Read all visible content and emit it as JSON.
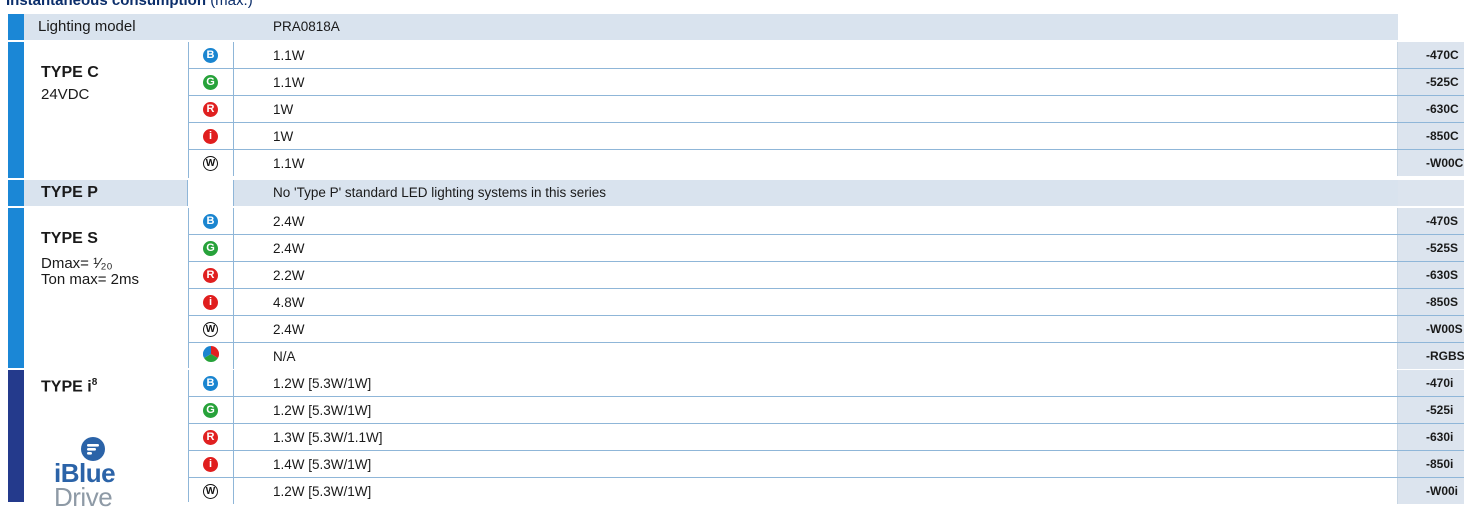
{
  "page": {
    "heading": "Instantaneous consumption",
    "heading_note": "(max.)"
  },
  "header_row": {
    "label": "Lighting model",
    "model": "PRA0818A"
  },
  "colors": {
    "type_c_bar": "#1b87d6",
    "type_s_bar": "#1b87d6",
    "type_i_bar": "#243a8c",
    "blue": "#1a85d0",
    "green": "#27a23a",
    "red": "#e02020",
    "ir": "#e01e1e",
    "header_bg": "#d9e3ee",
    "code_bg": "#dce4ee"
  },
  "groups": [
    {
      "id": "type_c",
      "title": "TYPE C",
      "subtitle": [
        "24VDC"
      ],
      "rows": [
        {
          "icon": "blue-led-icon",
          "badge": "B",
          "value": "1.1W",
          "code": "-470C"
        },
        {
          "icon": "green-led-icon",
          "badge": "G",
          "value": "1.1W",
          "code": "-525C"
        },
        {
          "icon": "red-led-icon",
          "badge": "R",
          "value": "1W",
          "code": "-630C"
        },
        {
          "icon": "infrared-led-icon",
          "badge": "i",
          "value": "1W",
          "code": "-850C"
        },
        {
          "icon": "white-led-icon",
          "badge": "W",
          "value": "1.1W",
          "code": "-W00C"
        }
      ]
    },
    {
      "id": "type_p",
      "title": "TYPE P",
      "note": "No 'Type P' standard LED lighting systems in this series"
    },
    {
      "id": "type_s",
      "title": "TYPE S",
      "subtitle": [
        "Dmax= ¹⁄₂₀",
        "Ton max= 2ms"
      ],
      "rows": [
        {
          "icon": "blue-led-icon",
          "badge": "B",
          "value": "2.4W",
          "code": "-470S"
        },
        {
          "icon": "green-led-icon",
          "badge": "G",
          "value": "2.4W",
          "code": "-525S"
        },
        {
          "icon": "red-led-icon",
          "badge": "R",
          "value": "2.2W",
          "code": "-630S"
        },
        {
          "icon": "infrared-led-icon",
          "badge": "i",
          "value": "4.8W",
          "code": "-850S"
        },
        {
          "icon": "white-led-icon",
          "badge": "W",
          "value": "2.4W",
          "code": "-W00S"
        },
        {
          "icon": "rgb-led-icon",
          "badge": "",
          "value": "N/A",
          "code": "-RGBS"
        }
      ]
    },
    {
      "id": "type_i",
      "title": "TYPE i",
      "title_sup": "8",
      "brand": {
        "line1": "iBlue",
        "line2": "Drive",
        "icon": "iblue-drive-logo-icon"
      },
      "rows": [
        {
          "icon": "blue-led-icon",
          "badge": "B",
          "value": "1.2W [5.3W/1W]",
          "code": "-470i"
        },
        {
          "icon": "green-led-icon",
          "badge": "G",
          "value": "1.2W [5.3W/1W]",
          "code": "-525i"
        },
        {
          "icon": "red-led-icon",
          "badge": "R",
          "value": "1.3W [5.3W/1.1W]",
          "code": "-630i"
        },
        {
          "icon": "infrared-led-icon",
          "badge": "i",
          "value": "1.4W [5.3W/1W]",
          "code": "-850i"
        },
        {
          "icon": "white-led-icon",
          "badge": "W",
          "value": "1.2W [5.3W/1W]",
          "code": "-W00i"
        }
      ]
    }
  ]
}
